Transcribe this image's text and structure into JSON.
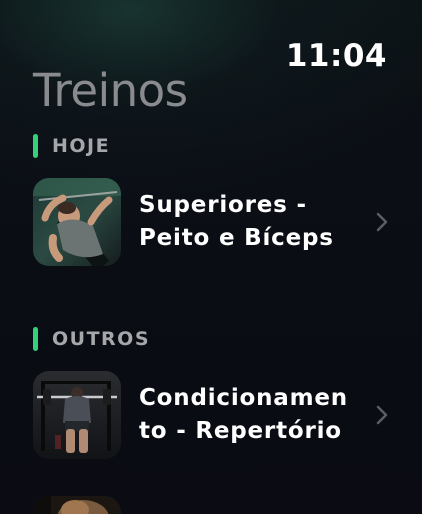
{
  "status": {
    "time": "11:04"
  },
  "page": {
    "title": "Treinos"
  },
  "sections": [
    {
      "label": "HOJE",
      "items": [
        {
          "label": "Superiores -\nPeito e Bíceps",
          "thumbnail_icon": "bench-press-photo"
        }
      ]
    },
    {
      "label": "OUTROS",
      "items": [
        {
          "label": "Condicionamen\nto - Repertório",
          "thumbnail_icon": "squat-rack-photo"
        },
        {
          "label": "",
          "thumbnail_icon": "workout-photo"
        }
      ]
    }
  ],
  "colors": {
    "accent": "#33d17a",
    "title": "#8a8b8f",
    "section_label": "#a6a7ab",
    "text": "#ffffff",
    "chevron": "#5c5e63"
  }
}
